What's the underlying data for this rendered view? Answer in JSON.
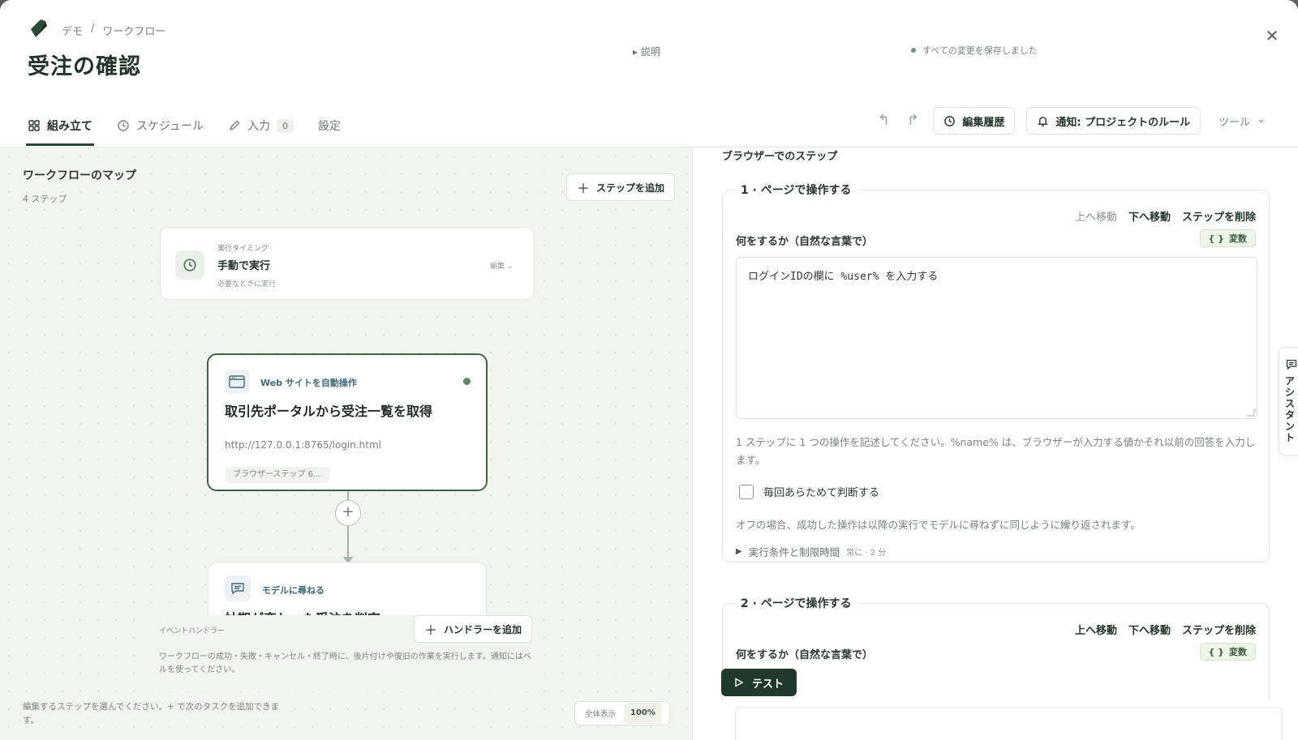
{
  "header": {
    "breadcrumb": [
      "デモ",
      "/",
      "ワークフロー"
    ],
    "title": "受注の確認",
    "description_toggle": "説明",
    "save_status": "すべての変更を保存しました"
  },
  "tabs": [
    {
      "label": "組み立て",
      "icon": "grid-icon",
      "active": true
    },
    {
      "label": "スケジュール",
      "icon": "clock-icon"
    },
    {
      "label": "入力",
      "icon": "pencil-icon",
      "count": "0"
    },
    {
      "label": "設定"
    }
  ],
  "toolbar": {
    "history_label": "編集履歴",
    "notify_label": "通知: プロジェクトのルール",
    "tools_label": "ツール"
  },
  "map": {
    "title": "ワークフローのマップ",
    "step_count": "4 ステップ",
    "add_step_label": "ステップを追加",
    "trigger": {
      "kicker": "実行タイミング",
      "title": "手動で実行",
      "subtitle": "必要なときに実行",
      "edit_label": "編集"
    },
    "step1": {
      "kind": "Web サイトを自動操作",
      "title": "取引先ポータルから受注一覧を取得",
      "url": "http://127.0.0.1:8765/login.html",
      "chip": "ブラウザーステップ 6..."
    },
    "step2": {
      "kind": "モデルに尋ねる",
      "title": "納期が変わった受注を判定"
    },
    "handlers": {
      "label": "イベントハンドラー",
      "add_label": "ハンドラーを追加",
      "description": "ワークフローの成功・失敗・キャンセル・終了時に、後片付けや復旧の作業を実行します。通知にはベルを使ってください。"
    },
    "hint": "編集するステップを選んでください。+ で次のタスクを追加できます。",
    "zoom_fit_label": "全体表示",
    "zoom_level": "100%"
  },
  "editor": {
    "heading": "ブラウザーでのステップ",
    "steps": [
      {
        "legend": "1 · ページで操作する",
        "move_up": "上へ移動",
        "move_down": "下へ移動",
        "delete": "ステップを削除",
        "field_label": "何をするか（自然な言葉で）",
        "var_label": "変数",
        "instruction": "ログインIDの欄に %user% を入力する",
        "help": "1 ステップに 1 つの操作を記述してください。%name% は、ブラウザーが入力する値かそれ以前の回答を入力します。",
        "checkbox_label": "毎回あらためて判断する",
        "checkbox_checked": false,
        "off_note": "オフの場合、成功した操作は以降の実行でモデルに尋ねずに同じように繰り返されます。",
        "conditions_label": "実行条件と制限時間",
        "conditions_meta": "常に · 2 分"
      },
      {
        "legend": "2 · ページで操作する",
        "move_up": "上へ移動",
        "move_down": "下へ移動",
        "delete": "ステップを削除",
        "field_label": "何をするか（自然な言葉で）",
        "var_label": "変数"
      }
    ],
    "test_label": "テスト"
  },
  "assistant": {
    "label": "アシスタント"
  },
  "colors": {
    "accent": "#2c4433",
    "active_step_border": "#3e6546",
    "test_button": "#1f3a2b",
    "status_dot": "#6f9a71"
  }
}
